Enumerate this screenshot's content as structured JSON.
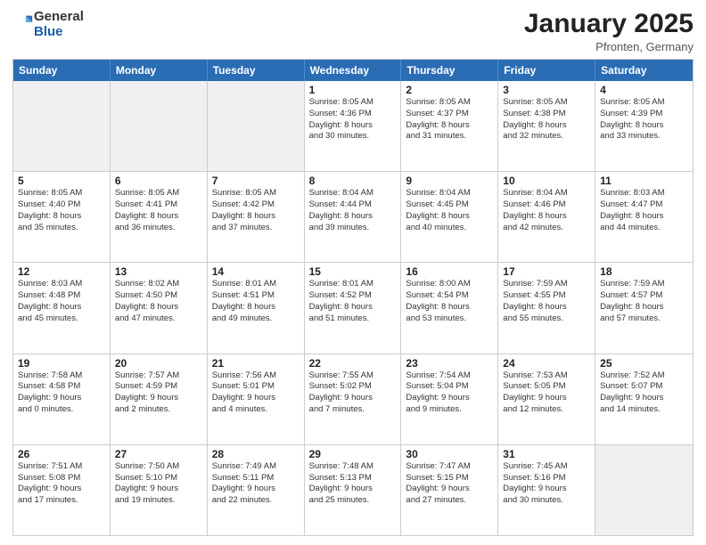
{
  "header": {
    "logo": {
      "general": "General",
      "blue": "Blue"
    },
    "title": "January 2025",
    "subtitle": "Pfronten, Germany"
  },
  "weekdays": [
    "Sunday",
    "Monday",
    "Tuesday",
    "Wednesday",
    "Thursday",
    "Friday",
    "Saturday"
  ],
  "weeks": [
    [
      {
        "day": "",
        "info": "",
        "shaded": true
      },
      {
        "day": "",
        "info": "",
        "shaded": true
      },
      {
        "day": "",
        "info": "",
        "shaded": true
      },
      {
        "day": "1",
        "info": "Sunrise: 8:05 AM\nSunset: 4:36 PM\nDaylight: 8 hours\nand 30 minutes.",
        "shaded": false
      },
      {
        "day": "2",
        "info": "Sunrise: 8:05 AM\nSunset: 4:37 PM\nDaylight: 8 hours\nand 31 minutes.",
        "shaded": false
      },
      {
        "day": "3",
        "info": "Sunrise: 8:05 AM\nSunset: 4:38 PM\nDaylight: 8 hours\nand 32 minutes.",
        "shaded": false
      },
      {
        "day": "4",
        "info": "Sunrise: 8:05 AM\nSunset: 4:39 PM\nDaylight: 8 hours\nand 33 minutes.",
        "shaded": false
      }
    ],
    [
      {
        "day": "5",
        "info": "Sunrise: 8:05 AM\nSunset: 4:40 PM\nDaylight: 8 hours\nand 35 minutes.",
        "shaded": false
      },
      {
        "day": "6",
        "info": "Sunrise: 8:05 AM\nSunset: 4:41 PM\nDaylight: 8 hours\nand 36 minutes.",
        "shaded": false
      },
      {
        "day": "7",
        "info": "Sunrise: 8:05 AM\nSunset: 4:42 PM\nDaylight: 8 hours\nand 37 minutes.",
        "shaded": false
      },
      {
        "day": "8",
        "info": "Sunrise: 8:04 AM\nSunset: 4:44 PM\nDaylight: 8 hours\nand 39 minutes.",
        "shaded": false
      },
      {
        "day": "9",
        "info": "Sunrise: 8:04 AM\nSunset: 4:45 PM\nDaylight: 8 hours\nand 40 minutes.",
        "shaded": false
      },
      {
        "day": "10",
        "info": "Sunrise: 8:04 AM\nSunset: 4:46 PM\nDaylight: 8 hours\nand 42 minutes.",
        "shaded": false
      },
      {
        "day": "11",
        "info": "Sunrise: 8:03 AM\nSunset: 4:47 PM\nDaylight: 8 hours\nand 44 minutes.",
        "shaded": false
      }
    ],
    [
      {
        "day": "12",
        "info": "Sunrise: 8:03 AM\nSunset: 4:48 PM\nDaylight: 8 hours\nand 45 minutes.",
        "shaded": false
      },
      {
        "day": "13",
        "info": "Sunrise: 8:02 AM\nSunset: 4:50 PM\nDaylight: 8 hours\nand 47 minutes.",
        "shaded": false
      },
      {
        "day": "14",
        "info": "Sunrise: 8:01 AM\nSunset: 4:51 PM\nDaylight: 8 hours\nand 49 minutes.",
        "shaded": false
      },
      {
        "day": "15",
        "info": "Sunrise: 8:01 AM\nSunset: 4:52 PM\nDaylight: 8 hours\nand 51 minutes.",
        "shaded": false
      },
      {
        "day": "16",
        "info": "Sunrise: 8:00 AM\nSunset: 4:54 PM\nDaylight: 8 hours\nand 53 minutes.",
        "shaded": false
      },
      {
        "day": "17",
        "info": "Sunrise: 7:59 AM\nSunset: 4:55 PM\nDaylight: 8 hours\nand 55 minutes.",
        "shaded": false
      },
      {
        "day": "18",
        "info": "Sunrise: 7:59 AM\nSunset: 4:57 PM\nDaylight: 8 hours\nand 57 minutes.",
        "shaded": false
      }
    ],
    [
      {
        "day": "19",
        "info": "Sunrise: 7:58 AM\nSunset: 4:58 PM\nDaylight: 9 hours\nand 0 minutes.",
        "shaded": false
      },
      {
        "day": "20",
        "info": "Sunrise: 7:57 AM\nSunset: 4:59 PM\nDaylight: 9 hours\nand 2 minutes.",
        "shaded": false
      },
      {
        "day": "21",
        "info": "Sunrise: 7:56 AM\nSunset: 5:01 PM\nDaylight: 9 hours\nand 4 minutes.",
        "shaded": false
      },
      {
        "day": "22",
        "info": "Sunrise: 7:55 AM\nSunset: 5:02 PM\nDaylight: 9 hours\nand 7 minutes.",
        "shaded": false
      },
      {
        "day": "23",
        "info": "Sunrise: 7:54 AM\nSunset: 5:04 PM\nDaylight: 9 hours\nand 9 minutes.",
        "shaded": false
      },
      {
        "day": "24",
        "info": "Sunrise: 7:53 AM\nSunset: 5:05 PM\nDaylight: 9 hours\nand 12 minutes.",
        "shaded": false
      },
      {
        "day": "25",
        "info": "Sunrise: 7:52 AM\nSunset: 5:07 PM\nDaylight: 9 hours\nand 14 minutes.",
        "shaded": false
      }
    ],
    [
      {
        "day": "26",
        "info": "Sunrise: 7:51 AM\nSunset: 5:08 PM\nDaylight: 9 hours\nand 17 minutes.",
        "shaded": false
      },
      {
        "day": "27",
        "info": "Sunrise: 7:50 AM\nSunset: 5:10 PM\nDaylight: 9 hours\nand 19 minutes.",
        "shaded": false
      },
      {
        "day": "28",
        "info": "Sunrise: 7:49 AM\nSunset: 5:11 PM\nDaylight: 9 hours\nand 22 minutes.",
        "shaded": false
      },
      {
        "day": "29",
        "info": "Sunrise: 7:48 AM\nSunset: 5:13 PM\nDaylight: 9 hours\nand 25 minutes.",
        "shaded": false
      },
      {
        "day": "30",
        "info": "Sunrise: 7:47 AM\nSunset: 5:15 PM\nDaylight: 9 hours\nand 27 minutes.",
        "shaded": false
      },
      {
        "day": "31",
        "info": "Sunrise: 7:45 AM\nSunset: 5:16 PM\nDaylight: 9 hours\nand 30 minutes.",
        "shaded": false
      },
      {
        "day": "",
        "info": "",
        "shaded": true
      }
    ]
  ]
}
